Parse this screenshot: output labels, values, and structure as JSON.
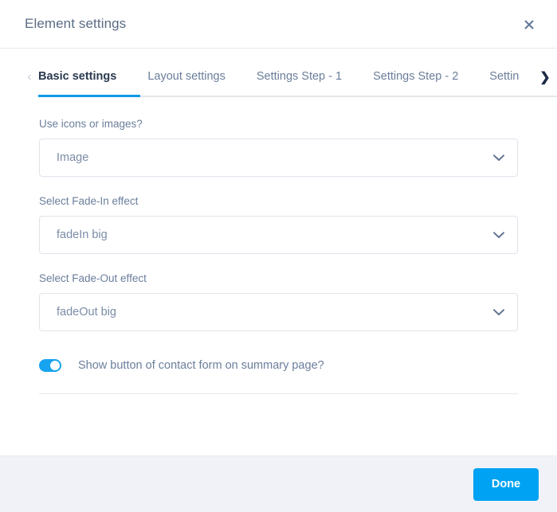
{
  "header": {
    "title": "Element settings",
    "close_label": "×"
  },
  "tabstrip": {
    "prev_arrow": "‹",
    "next_arrow": "❯",
    "tabs": [
      {
        "label": "Basic settings",
        "active": true
      },
      {
        "label": "Layout settings",
        "active": false
      },
      {
        "label": "Settings Step - 1",
        "active": false
      },
      {
        "label": "Settings Step - 2",
        "active": false
      },
      {
        "label": "Settin",
        "active": false
      }
    ]
  },
  "form": {
    "fields": [
      {
        "label": "Use icons or images?",
        "value": "Image",
        "icon": "chevron-down-icon"
      },
      {
        "label": "Select Fade-In effect",
        "value": "fadeIn big",
        "icon": "chevron-down-icon"
      },
      {
        "label": "Select Fade-Out effect",
        "value": "fadeOut big",
        "icon": "chevron-down-icon"
      }
    ],
    "toggle": {
      "label": "Show button of contact form on summary page?",
      "state": "on"
    }
  },
  "footer": {
    "done_label": "Done"
  },
  "colors": {
    "accent": "#00a2f3",
    "toggle_on": "#17a3f0",
    "tab_active_underline": "#0d9ae6",
    "text_muted": "#6b7e9b",
    "footer_bg": "#f1f2f7"
  }
}
